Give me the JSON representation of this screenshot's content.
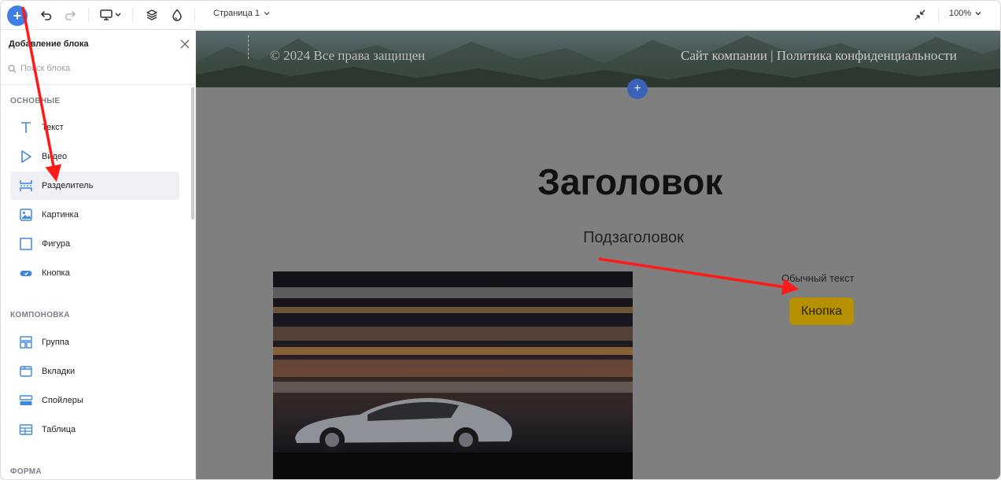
{
  "toolbar": {
    "add_symbol": "+",
    "page_name": "Страница 1",
    "zoom_level": "100%"
  },
  "sidebar": {
    "title": "Добавление блока",
    "search_placeholder": "Поиск блока",
    "sections": [
      {
        "title": "ОСНОВНЫЕ",
        "items": [
          {
            "label": "Текст",
            "icon": "text-icon"
          },
          {
            "label": "Видео",
            "icon": "video-icon"
          },
          {
            "label": "Разделитель",
            "icon": "divider-icon",
            "active": true
          },
          {
            "label": "Картинка",
            "icon": "image-icon"
          },
          {
            "label": "Фигура",
            "icon": "shape-icon"
          },
          {
            "label": "Кнопка",
            "icon": "button-icon"
          }
        ]
      },
      {
        "title": "КОМПОНОВКА",
        "items": [
          {
            "label": "Группа",
            "icon": "group-icon"
          },
          {
            "label": "Вкладки",
            "icon": "tabs-icon"
          },
          {
            "label": "Спойлеры",
            "icon": "spoilers-icon"
          },
          {
            "label": "Таблица",
            "icon": "table-icon"
          }
        ]
      },
      {
        "title": "ФОРМА",
        "items": []
      }
    ]
  },
  "canvas": {
    "footer_copyright": "© 2024 Все права защищен",
    "footer_links": "Сайт компании | Политика конфиденциальности",
    "add_symbol": "+",
    "heading": "Заголовок",
    "subheading": "Подзаголовок",
    "body_text": "Обычный текст",
    "button_label": "Кнопка"
  },
  "colors": {
    "accent": "#3f7de8",
    "button_yellow": "#b59000",
    "annotation_arrow": "#ff0000"
  }
}
